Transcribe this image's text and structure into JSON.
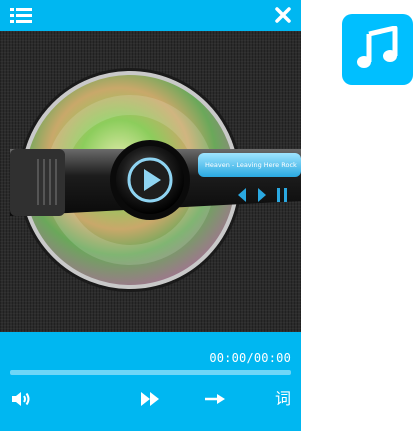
{
  "player": {
    "time_display": "00:00/00:00",
    "progress": 0,
    "lyrics_label": "词",
    "album_art_label": "Heaven - Leaving Here Rock",
    "icons": {
      "menu": "list-menu-icon",
      "close": "close-icon",
      "play": "play-icon",
      "volume": "volume-icon",
      "next": "fast-forward-icon",
      "mode": "sequential-play-arrow-icon"
    }
  },
  "desktop": {
    "icon": "music-note-icon"
  },
  "colors": {
    "accent": "#00b7f1",
    "progress_track": "#6fd6f7",
    "app_icon": "#00bfff"
  }
}
